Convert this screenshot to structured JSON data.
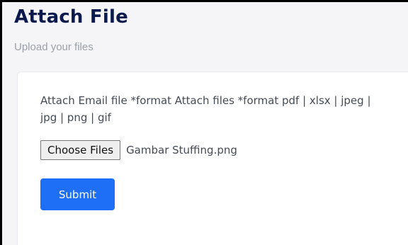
{
  "header": {
    "title": "Attach File",
    "subtitle": "Upload your files"
  },
  "form": {
    "attach_label": "Attach Email file *format Attach files *format pdf | xlsx | jpeg | jpg | png | gif",
    "choose_files_label": "Choose Files",
    "selected_file": "Gambar Stuffing.png",
    "submit_label": "Submit"
  },
  "colors": {
    "title": "#0b1a4d",
    "background": "#f5f5f7",
    "card": "#ffffff",
    "primary_button": "#1e6ff5"
  }
}
